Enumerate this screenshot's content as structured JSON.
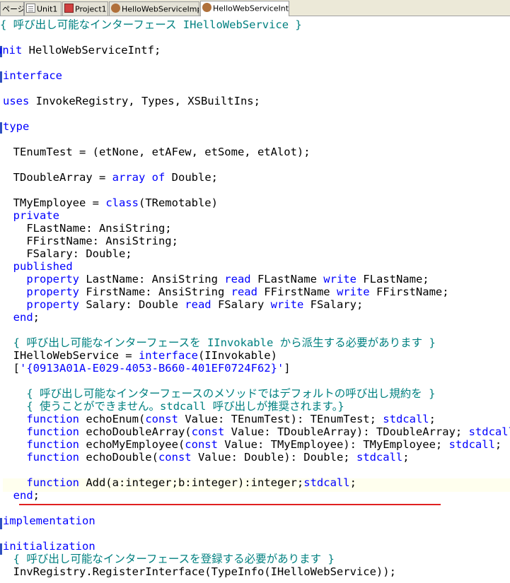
{
  "tabs": [
    {
      "label": "ページ",
      "icon": "page-icon"
    },
    {
      "label": "Unit1",
      "icon": "unit-icon"
    },
    {
      "label": "Project1",
      "icon": "project-icon"
    },
    {
      "label": "HelloWebServiceImpl",
      "icon": "web-service-icon"
    },
    {
      "label": "HelloWebServiceIntf",
      "icon": "web-service-icon",
      "active": true
    }
  ],
  "code": {
    "l1": "{ 呼び出し可能なインターフェース IHelloWebService }",
    "l3_kw": "unit",
    "l3_rest": " HelloWebServiceIntf;",
    "l5_kw": "interface",
    "l7_kw": "uses",
    "l7_rest": " InvokeRegistry, Types, XSBuiltIns;",
    "l9_kw": "type",
    "l11": "  TEnumTest = (etNone, etAFew, etSome, etAlot);",
    "l13_a": "  TDoubleArray = ",
    "l13_kw1": "array",
    "l13_b": " ",
    "l13_kw2": "of",
    "l13_c": " Double;",
    "l15_a": "  TMyEmployee = ",
    "l15_kw": "class",
    "l15_b": "(TRemotable)",
    "l16_kw": "  private",
    "l17": "    FLastName: AnsiString;",
    "l18": "    FFirstName: AnsiString;",
    "l19": "    FSalary: Double;",
    "l20_kw": "  published",
    "l21_kw1": "    property",
    "l21_a": " LastName: AnsiString ",
    "l21_kw2": "read",
    "l21_b": " FLastName ",
    "l21_kw3": "write",
    "l21_c": " FLastName;",
    "l22_kw1": "    property",
    "l22_a": " FirstName: AnsiString ",
    "l22_kw2": "read",
    "l22_b": " FFirstName ",
    "l22_kw3": "write",
    "l22_c": " FFirstName;",
    "l23_kw1": "    property",
    "l23_a": " Salary: Double ",
    "l23_kw2": "read",
    "l23_b": " FSalary ",
    "l23_kw3": "write",
    "l23_c": " FSalary;",
    "l24_kw": "  end",
    "l24_rest": ";",
    "l26": "  { 呼び出し可能なインターフェースを IInvokable から派生する必要があります }",
    "l27_a": "  IHelloWebService = ",
    "l27_kw": "interface",
    "l27_b": "(IInvokable)",
    "l28_a": "  [",
    "l28_str": "'{0913A01A-E029-4053-B660-401EF0724F62}'",
    "l28_b": "]",
    "l30": "    { 呼び出し可能なインターフェースのメソッドではデフォルトの呼び出し規約を }",
    "l31": "    { 使うことができません。stdcall 呼び出しが推奨されます。}",
    "l32_kw1": "    function",
    "l32_a": " echoEnum(",
    "l32_kw2": "const",
    "l32_b": " Value: TEnumTest): TEnumTest; ",
    "l32_kw3": "stdcall",
    "l32_c": ";",
    "l33_kw1": "    function",
    "l33_a": " echoDoubleArray(",
    "l33_kw2": "const",
    "l33_b": " Value: TDoubleArray): TDoubleArray; ",
    "l33_kw3": "stdcall",
    "l33_c": ";",
    "l34_kw1": "    function",
    "l34_a": " echoMyEmployee(",
    "l34_kw2": "const",
    "l34_b": " Value: TMyEmployee): TMyEmployee; ",
    "l34_kw3": "stdcall",
    "l34_c": ";",
    "l35_kw1": "    function",
    "l35_a": " echoDouble(",
    "l35_kw2": "const",
    "l35_b": " Value: Double): Double; ",
    "l35_kw3": "stdcall",
    "l35_c": ";",
    "l37_kw1": "    function",
    "l37_a": " Add(a:integer;b:integer):integer;",
    "l37_kw2": "stdcall",
    "l37_b": ";",
    "l38_kw": "  end",
    "l38_rest": ";",
    "l40_kw": "implementation",
    "l42_kw": "initialization",
    "l43": "  { 呼び出し可能なインターフェースを登録する必要があります }",
    "l44": "  InvRegistry.RegisterInterface(TypeInfo(IHelloWebService));"
  },
  "colors": {
    "keyword": "#0000ff",
    "comment": "#008080",
    "text": "#000000",
    "current_line": "#ffffee",
    "underline": "#e02020"
  }
}
